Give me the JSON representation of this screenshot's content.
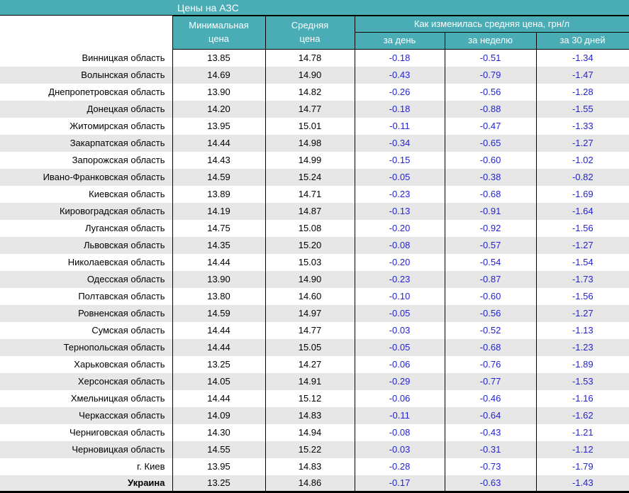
{
  "title_bar": {
    "title": "Цены на АЗС"
  },
  "table": {
    "header": {
      "min_price_line1": "Минимальная",
      "min_price_line2": "цена",
      "avg_price_line1": "Средняя",
      "avg_price_line2": "цена",
      "change_group_title": "Как изменилась средняя цена, грн/л",
      "change_day": "за день",
      "change_week": "за неделю",
      "change_30days": "за 30 дней"
    },
    "rows": [
      {
        "region": "Винницкая область",
        "min": "13.85",
        "avg": "14.78",
        "day": "-0.18",
        "week": "-0.51",
        "days30": "-1.34"
      },
      {
        "region": "Волынская область",
        "min": "14.69",
        "avg": "14.90",
        "day": "-0.43",
        "week": "-0.79",
        "days30": "-1.47"
      },
      {
        "region": "Днепропетровская область",
        "min": "13.90",
        "avg": "14.82",
        "day": "-0.26",
        "week": "-0.56",
        "days30": "-1.28"
      },
      {
        "region": "Донецкая область",
        "min": "14.20",
        "avg": "14.77",
        "day": "-0.18",
        "week": "-0.88",
        "days30": "-1.55"
      },
      {
        "region": "Житомирская область",
        "min": "13.95",
        "avg": "15.01",
        "day": "-0.11",
        "week": "-0.47",
        "days30": "-1.33"
      },
      {
        "region": "Закарпатская область",
        "min": "14.44",
        "avg": "14.98",
        "day": "-0.34",
        "week": "-0.65",
        "days30": "-1.27"
      },
      {
        "region": "Запорожская область",
        "min": "14.43",
        "avg": "14.99",
        "day": "-0.15",
        "week": "-0.60",
        "days30": "-1.02"
      },
      {
        "region": "Ивано-Франковская область",
        "min": "14.59",
        "avg": "15.24",
        "day": "-0.05",
        "week": "-0.38",
        "days30": "-0.82"
      },
      {
        "region": "Киевская область",
        "min": "13.89",
        "avg": "14.71",
        "day": "-0.23",
        "week": "-0.68",
        "days30": "-1.69"
      },
      {
        "region": "Кировоградская область",
        "min": "14.19",
        "avg": "14.87",
        "day": "-0.13",
        "week": "-0.91",
        "days30": "-1.64"
      },
      {
        "region": "Луганская область",
        "min": "14.75",
        "avg": "15.08",
        "day": "-0.20",
        "week": "-0.92",
        "days30": "-1.56"
      },
      {
        "region": "Львовская область",
        "min": "14.35",
        "avg": "15.20",
        "day": "-0.08",
        "week": "-0.57",
        "days30": "-1.27"
      },
      {
        "region": "Николаевская область",
        "min": "14.44",
        "avg": "15.03",
        "day": "-0.20",
        "week": "-0.54",
        "days30": "-1.54"
      },
      {
        "region": "Одесская область",
        "min": "13.90",
        "avg": "14.90",
        "day": "-0.23",
        "week": "-0.87",
        "days30": "-1.73"
      },
      {
        "region": "Полтавская область",
        "min": "13.80",
        "avg": "14.60",
        "day": "-0.10",
        "week": "-0.60",
        "days30": "-1.56"
      },
      {
        "region": "Ровненская область",
        "min": "14.59",
        "avg": "14.97",
        "day": "-0.05",
        "week": "-0.56",
        "days30": "-1.27"
      },
      {
        "region": "Сумская область",
        "min": "14.44",
        "avg": "14.77",
        "day": "-0.03",
        "week": "-0.52",
        "days30": "-1.13"
      },
      {
        "region": "Тернопольская область",
        "min": "14.44",
        "avg": "15.05",
        "day": "-0.05",
        "week": "-0.68",
        "days30": "-1.23"
      },
      {
        "region": "Харьковская область",
        "min": "13.25",
        "avg": "14.27",
        "day": "-0.06",
        "week": "-0.76",
        "days30": "-1.89"
      },
      {
        "region": "Херсонская область",
        "min": "14.05",
        "avg": "14.91",
        "day": "-0.29",
        "week": "-0.77",
        "days30": "-1.53"
      },
      {
        "region": "Хмельницкая область",
        "min": "14.44",
        "avg": "15.12",
        "day": "-0.06",
        "week": "-0.46",
        "days30": "-1.16"
      },
      {
        "region": "Черкасская область",
        "min": "14.09",
        "avg": "14.83",
        "day": "-0.11",
        "week": "-0.64",
        "days30": "-1.62"
      },
      {
        "region": "Черниговская область",
        "min": "14.30",
        "avg": "14.94",
        "day": "-0.08",
        "week": "-0.43",
        "days30": "-1.21"
      },
      {
        "region": "Черновицкая область",
        "min": "14.55",
        "avg": "15.22",
        "day": "-0.03",
        "week": "-0.31",
        "days30": "-1.12"
      },
      {
        "region": "г. Киев",
        "min": "13.95",
        "avg": "14.83",
        "day": "-0.28",
        "week": "-0.73",
        "days30": "-1.79"
      },
      {
        "region": "Украина",
        "min": "13.25",
        "avg": "14.86",
        "day": "-0.17",
        "week": "-0.63",
        "days30": "-1.43",
        "bold": true
      }
    ]
  },
  "colors": {
    "header_teal": "#4aacb4",
    "stripe_gray": "#e7e7e7",
    "change_blue": "#2323d3",
    "border_black": "#000000"
  }
}
